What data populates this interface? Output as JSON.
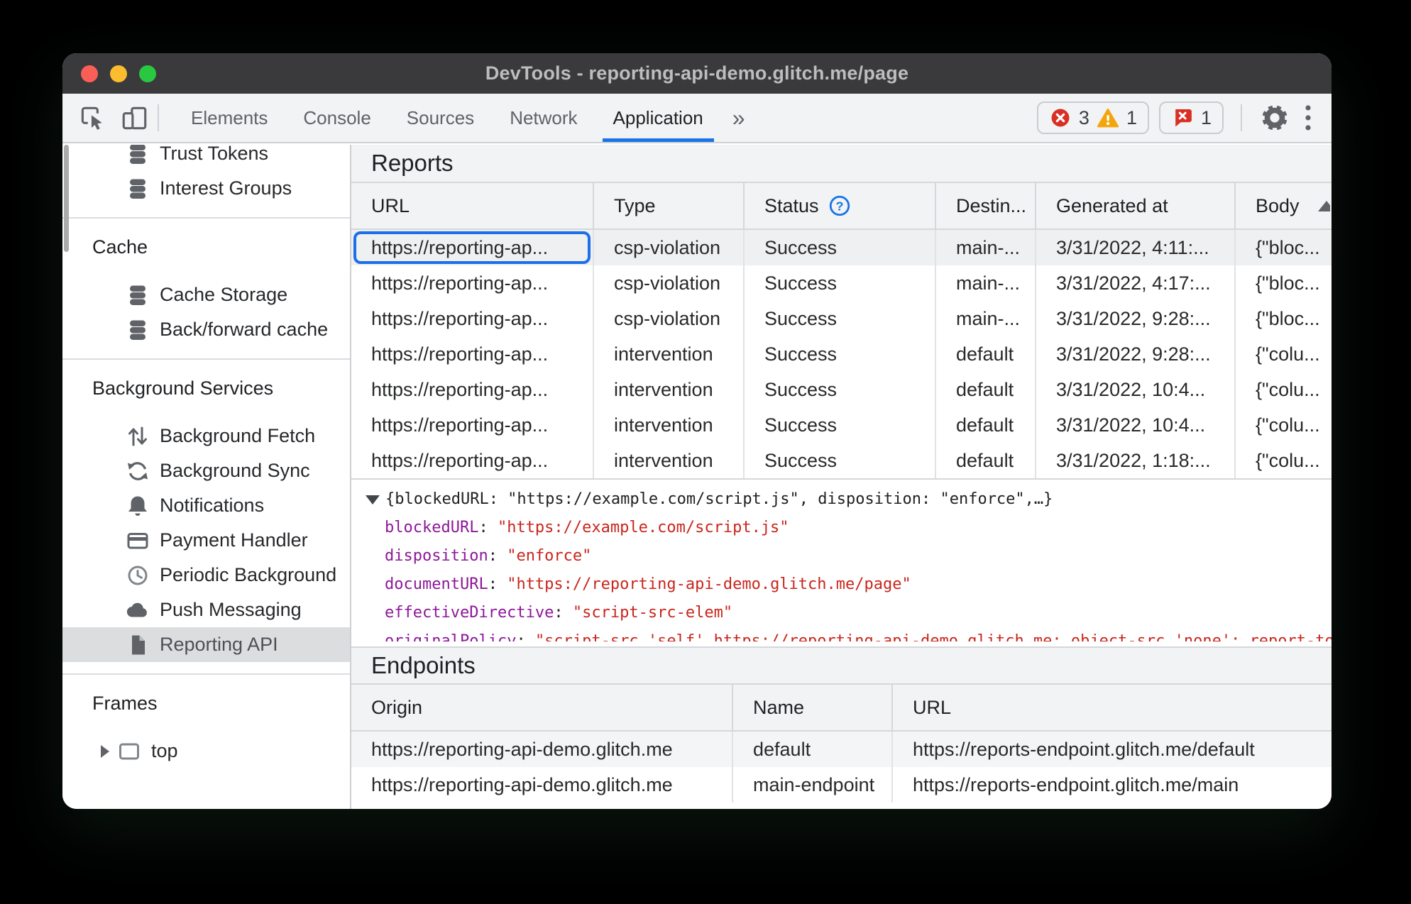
{
  "window": {
    "title": "DevTools - reporting-api-demo.glitch.me/page"
  },
  "toolbar": {
    "tabs": [
      {
        "label": "Elements",
        "active": false
      },
      {
        "label": "Console",
        "active": false
      },
      {
        "label": "Sources",
        "active": false
      },
      {
        "label": "Network",
        "active": false
      },
      {
        "label": "Application",
        "active": true
      }
    ],
    "more_tabs_label": "»",
    "error_count": "3",
    "warning_count": "1",
    "issue_count": "1",
    "icons": [
      "inspect-icon",
      "device-toolbar-icon",
      "error-icon",
      "warning-icon",
      "issues-icon",
      "settings-gear-icon",
      "kebab-menu-icon"
    ]
  },
  "sidebar": {
    "entries": [
      {
        "type": "item",
        "icon": "database",
        "label": "Trust Tokens",
        "clipped": true
      },
      {
        "type": "item",
        "icon": "database",
        "label": "Interest Groups"
      },
      {
        "type": "divider",
        "interactable": false
      },
      {
        "type": "header",
        "label": "Cache",
        "interactable": false
      },
      {
        "type": "item",
        "icon": "database",
        "label": "Cache Storage"
      },
      {
        "type": "item",
        "icon": "database",
        "label": "Back/forward cache"
      },
      {
        "type": "divider",
        "interactable": false
      },
      {
        "type": "header",
        "label": "Background Services",
        "interactable": false
      },
      {
        "type": "item",
        "icon": "background-fetch",
        "label": "Background Fetch"
      },
      {
        "type": "item",
        "icon": "background-sync",
        "label": "Background Sync"
      },
      {
        "type": "item",
        "icon": "notifications",
        "label": "Notifications"
      },
      {
        "type": "item",
        "icon": "payment-handler",
        "label": "Payment Handler"
      },
      {
        "type": "item",
        "icon": "periodic-background",
        "label": "Periodic Background"
      },
      {
        "type": "item",
        "icon": "push-messaging",
        "label": "Push Messaging"
      },
      {
        "type": "item",
        "icon": "reporting-api",
        "label": "Reporting API",
        "selected": true
      },
      {
        "type": "divider",
        "interactable": false
      },
      {
        "type": "header",
        "label": "Frames",
        "interactable": false
      },
      {
        "type": "item",
        "icon": "frame",
        "label": "top",
        "disc": true
      }
    ]
  },
  "reports": {
    "title": "Reports",
    "columns": {
      "url": "URL",
      "type": "Type",
      "status": "Status",
      "destination": "Destin...",
      "generated": "Generated at",
      "body": "Body"
    },
    "rows": [
      {
        "url": "https://reporting-ap...",
        "type": "csp-violation",
        "status": "Success",
        "destination": "main-...",
        "generated": "3/31/2022, 4:11:...",
        "body": "{\"bloc...",
        "selected": true
      },
      {
        "url": "https://reporting-ap...",
        "type": "csp-violation",
        "status": "Success",
        "destination": "main-...",
        "generated": "3/31/2022, 4:17:...",
        "body": "{\"bloc..."
      },
      {
        "url": "https://reporting-ap...",
        "type": "csp-violation",
        "status": "Success",
        "destination": "main-...",
        "generated": "3/31/2022, 9:28:...",
        "body": "{\"bloc..."
      },
      {
        "url": "https://reporting-ap...",
        "type": "intervention",
        "status": "Success",
        "destination": "default",
        "generated": "3/31/2022, 9:28:...",
        "body": "{\"colu..."
      },
      {
        "url": "https://reporting-ap...",
        "type": "intervention",
        "status": "Success",
        "destination": "default",
        "generated": "3/31/2022, 10:4...",
        "body": "{\"colu..."
      },
      {
        "url": "https://reporting-ap...",
        "type": "intervention",
        "status": "Success",
        "destination": "default",
        "generated": "3/31/2022, 10:4...",
        "body": "{\"colu..."
      },
      {
        "url": "https://reporting-ap...",
        "type": "intervention",
        "status": "Success",
        "destination": "default",
        "generated": "3/31/2022, 1:18:...",
        "body": "{\"colu..."
      }
    ]
  },
  "detail": {
    "preview": "{blockedURL: \"https://example.com/script.js\", disposition: \"enforce\",…}",
    "properties": [
      {
        "key": "blockedURL",
        "value": "\"https://example.com/script.js\""
      },
      {
        "key": "disposition",
        "value": "\"enforce\""
      },
      {
        "key": "documentURL",
        "value": "\"https://reporting-api-demo.glitch.me/page\""
      },
      {
        "key": "effectiveDirective",
        "value": "\"script-src-elem\""
      }
    ],
    "clipped": {
      "key": "originalPolicy",
      "value": "\"script-src 'self' https://reporting-api-demo.glitch.me; object-src 'none'; report-to main-endpoint\""
    }
  },
  "endpoints": {
    "title": "Endpoints",
    "columns": {
      "origin": "Origin",
      "name": "Name",
      "url": "URL"
    },
    "rows": [
      {
        "origin": "https://reporting-api-demo.glitch.me",
        "name": "default",
        "url": "https://reports-endpoint.glitch.me/default"
      },
      {
        "origin": "https://reporting-api-demo.glitch.me",
        "name": "main-endpoint",
        "url": "https://reports-endpoint.glitch.me/main"
      }
    ]
  },
  "colors": {
    "accent_blue": "#1a73e8",
    "error_red": "#d93025",
    "warning_yellow": "#f4a50c",
    "json_key_purple": "#8e179a",
    "json_value_red": "#c9261d",
    "titlebar_bg": "#3a3a3c",
    "toolbar_bg": "#f1f3f4",
    "selection_gray": "#dcddde"
  }
}
